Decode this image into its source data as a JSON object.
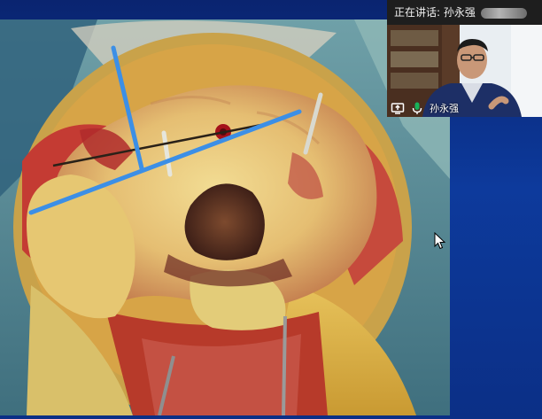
{
  "meeting": {
    "speaking_label": "正在讲话: 孙永强",
    "participant_name": "孙永强",
    "icons": [
      "screen-share-icon",
      "microphone-icon",
      "mouse-cursor-icon"
    ]
  },
  "colors": {
    "slide_background": "#0b2f86",
    "annotation_line": "#3c8fe6",
    "tile_bar": "#1e1e1e",
    "mic_active": "#18b35a"
  }
}
